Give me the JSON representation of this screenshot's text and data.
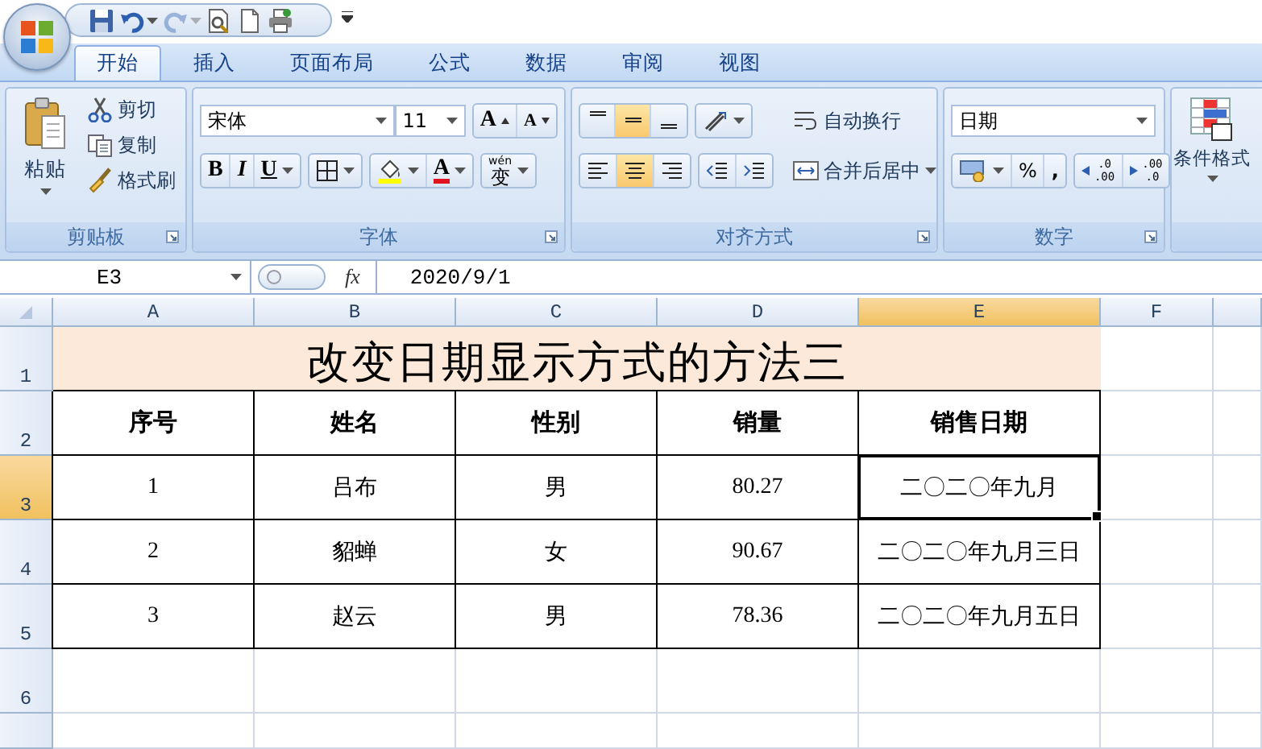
{
  "quick_access": {
    "buttons": [
      {
        "kind": "save",
        "disabled": false
      },
      {
        "kind": "undo",
        "disabled": false
      },
      {
        "kind": "redo",
        "disabled": true
      },
      {
        "kind": "print_preview",
        "disabled": false
      },
      {
        "kind": "new",
        "disabled": false
      },
      {
        "kind": "print",
        "disabled": false
      }
    ]
  },
  "tabs": [
    {
      "label": "开始",
      "selected": true
    },
    {
      "label": "插入",
      "selected": false
    },
    {
      "label": "页面布局",
      "selected": false
    },
    {
      "label": "公式",
      "selected": false
    },
    {
      "label": "数据",
      "selected": false
    },
    {
      "label": "审阅",
      "selected": false
    },
    {
      "label": "视图",
      "selected": false
    }
  ],
  "ribbon": {
    "clipboard": {
      "title": "剪贴板",
      "paste": "粘贴",
      "cut": "剪切",
      "copy": "复制",
      "format_painter": "格式刷"
    },
    "font": {
      "title": "字体",
      "font_name": "宋体",
      "font_size": "11",
      "grow": "A",
      "shrink": "A",
      "bold": "B",
      "italic": "I",
      "underline": "U",
      "font_color": "A",
      "phonetic_top": "wén",
      "phonetic_main": "变"
    },
    "alignment": {
      "title": "对齐方式",
      "vertical": [
        {
          "kind": "top",
          "selected": false
        },
        {
          "kind": "middle",
          "selected": true
        },
        {
          "kind": "bottom",
          "selected": false
        }
      ],
      "horizontal": [
        {
          "kind": "left",
          "selected": false
        },
        {
          "kind": "center",
          "selected": true
        },
        {
          "kind": "right",
          "selected": false
        }
      ],
      "wrap_text": "自动换行",
      "merge_center": "合并后居中"
    },
    "number": {
      "title": "数字",
      "format": "日期",
      "percent": "%",
      "comma": ",",
      "decimal_increase": [
        ".0",
        ".00"
      ],
      "decimal_decrease": [
        ".00",
        ".0"
      ]
    },
    "styles": {
      "conditional_format": "条件格式"
    }
  },
  "formula_bar": {
    "name_box": "E3",
    "function_label": "fx",
    "value": "2020/9/1"
  },
  "sheet": {
    "columns": [
      {
        "label": "A",
        "selected": false
      },
      {
        "label": "B",
        "selected": false
      },
      {
        "label": "C",
        "selected": false
      },
      {
        "label": "D",
        "selected": false
      },
      {
        "label": "E",
        "selected": true
      },
      {
        "label": "F",
        "selected": false
      }
    ],
    "rows": [
      {
        "label": "1",
        "selected": false
      },
      {
        "label": "2",
        "selected": false
      },
      {
        "label": "3",
        "selected": true
      },
      {
        "label": "4",
        "selected": false
      },
      {
        "label": "5",
        "selected": false
      },
      {
        "label": "6",
        "selected": false
      }
    ],
    "title": "改变日期显示方式的方法三",
    "header": [
      "序号",
      "姓名",
      "性别",
      "销量",
      "销售日期"
    ],
    "records": [
      {
        "cells": [
          {
            "text": "1",
            "selected": false
          },
          {
            "text": "吕布",
            "selected": false
          },
          {
            "text": "男",
            "selected": false
          },
          {
            "text": "80.27",
            "selected": false
          },
          {
            "text": "二〇二〇年九月",
            "selected": true
          }
        ]
      },
      {
        "cells": [
          {
            "text": "2",
            "selected": false
          },
          {
            "text": "貂蝉",
            "selected": false
          },
          {
            "text": "女",
            "selected": false
          },
          {
            "text": "90.67",
            "selected": false
          },
          {
            "text": "二〇二〇年九月三日",
            "selected": false
          }
        ]
      },
      {
        "cells": [
          {
            "text": "3",
            "selected": false
          },
          {
            "text": "赵云",
            "selected": false
          },
          {
            "text": "男",
            "selected": false
          },
          {
            "text": "78.36",
            "selected": false
          },
          {
            "text": "二〇二〇年九月五日",
            "selected": false
          }
        ]
      }
    ]
  }
}
